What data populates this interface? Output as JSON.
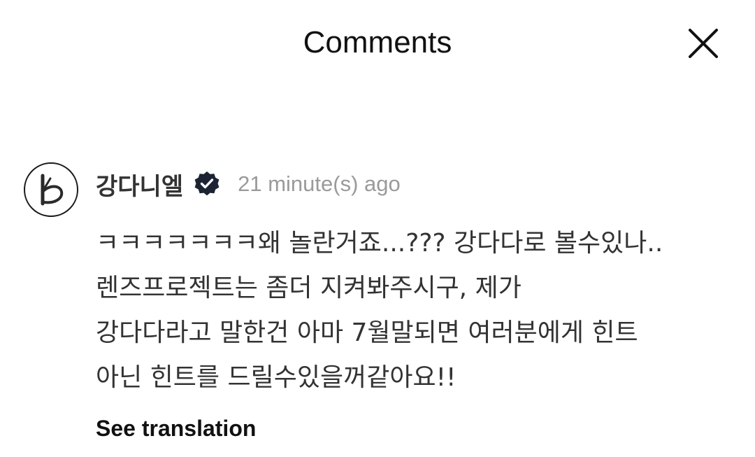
{
  "header": {
    "title": "Comments",
    "close_icon": "close-icon"
  },
  "comment": {
    "avatar_icon": "k-logo-avatar",
    "username": "강다니엘",
    "verified_icon": "verified-badge-icon",
    "timestamp": "21 minute(s) ago",
    "lines": [
      "ㅋㅋㅋㅋㅋㅋㅋ왜 놀란거죠...??? 강다다로 볼수있나..",
      "렌즈프로젝트는 좀더 지켜봐주시구, 제가",
      "강다다라고 말한건 아마 7월말되면 여러분에게 힌트",
      "아닌 힌트를 드릴수있을꺼같아요!!"
    ],
    "see_translation": "See translation"
  },
  "colors": {
    "text_primary": "#333333",
    "text_muted": "#9a9a9a",
    "badge": "#1c2333"
  }
}
